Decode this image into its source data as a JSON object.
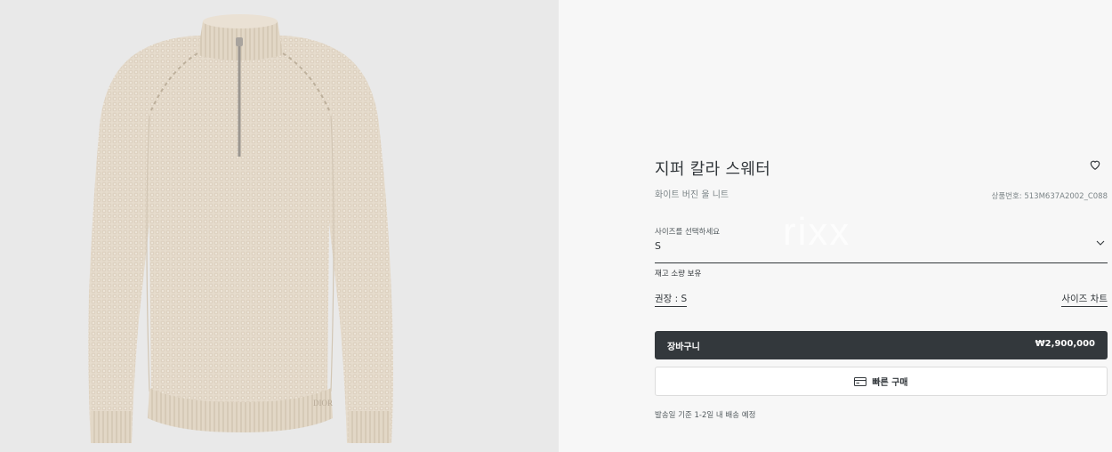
{
  "product": {
    "title": "지퍼 칼라 스웨터",
    "subtitle": "화이트 버진 울 니트",
    "reference": "상품번호: 513M637A2002_C088",
    "image_alt": "DIOR",
    "watermark": "rixx"
  },
  "size_select": {
    "label": "사이즈를 선택하세요",
    "value": "S"
  },
  "stock_text": "재고 소량 보유",
  "recommended_size": "권장 : S",
  "size_chart_link": "사이즈 차트",
  "cart_button": {
    "label": "장바구니",
    "price": "₩2,900,000"
  },
  "quick_buy_label": "빠른 구매",
  "delivery_text": "발송일 기준 1-2일 내 배송 예정",
  "icons": [
    "heart-icon",
    "chevron-down-icon",
    "credit-card-icon"
  ],
  "colors": {
    "primary": "#33383c",
    "background": "#f7f7f7",
    "sweater": "#e4d9c9"
  }
}
